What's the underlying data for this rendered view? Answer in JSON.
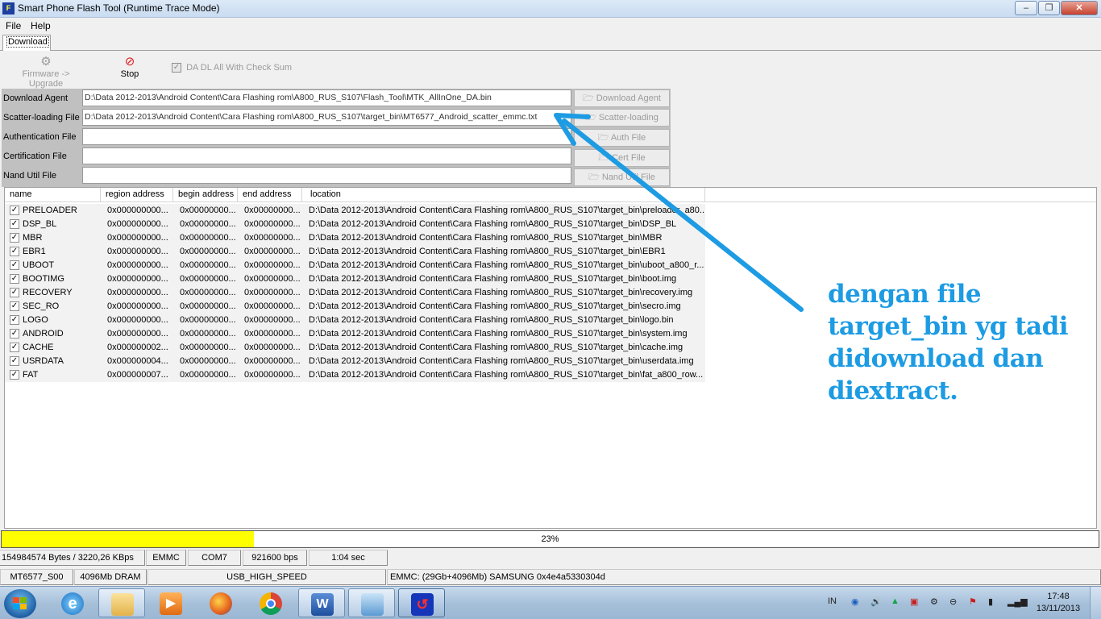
{
  "window": {
    "title": "Smart Phone Flash Tool (Runtime Trace Mode)",
    "icon_label": "F",
    "controls": [
      "‒",
      "❐",
      "✕"
    ]
  },
  "menu": [
    "File",
    "Help"
  ],
  "tabs": [
    "Download"
  ],
  "toolbar": {
    "firmware_upgrade": "Firmware -> Upgrade",
    "stop": "Stop",
    "checksum_label": "DA DL All With Check Sum",
    "checksum_checked": true
  },
  "files": [
    {
      "label": "Download Agent",
      "value": "D:\\Data 2012-2013\\Android Content\\Cara Flashing rom\\A800_RUS_S107\\Flash_Tool\\MTK_AllInOne_DA.bin",
      "button": "Download Agent"
    },
    {
      "label": "Scatter-loading File",
      "value": "D:\\Data 2012-2013\\Android Content\\Cara Flashing rom\\A800_RUS_S107\\target_bin\\MT6577_Android_scatter_emmc.txt",
      "button": "Scatter-loading"
    },
    {
      "label": "Authentication File",
      "value": "",
      "button": "Auth File"
    },
    {
      "label": "Certification File",
      "value": "",
      "button": "Cert File"
    },
    {
      "label": "Nand Util File",
      "value": "",
      "button": "Nand Util File"
    }
  ],
  "table": {
    "columns": [
      "name",
      "region address",
      "begin address",
      "end address",
      "location"
    ],
    "rows": [
      {
        "name": "PRELOADER",
        "region": "0x000000000...",
        "begin": "0x00000000...",
        "end": "0x00000000...",
        "location": "D:\\Data 2012-2013\\Android Content\\Cara Flashing rom\\A800_RUS_S107\\target_bin\\preloader_a80..."
      },
      {
        "name": "DSP_BL",
        "region": "0x000000000...",
        "begin": "0x00000000...",
        "end": "0x00000000...",
        "location": "D:\\Data 2012-2013\\Android Content\\Cara Flashing rom\\A800_RUS_S107\\target_bin\\DSP_BL"
      },
      {
        "name": "MBR",
        "region": "0x000000000...",
        "begin": "0x00000000...",
        "end": "0x00000000...",
        "location": "D:\\Data 2012-2013\\Android Content\\Cara Flashing rom\\A800_RUS_S107\\target_bin\\MBR"
      },
      {
        "name": "EBR1",
        "region": "0x000000000...",
        "begin": "0x00000000...",
        "end": "0x00000000...",
        "location": "D:\\Data 2012-2013\\Android Content\\Cara Flashing rom\\A800_RUS_S107\\target_bin\\EBR1"
      },
      {
        "name": "UBOOT",
        "region": "0x000000000...",
        "begin": "0x00000000...",
        "end": "0x00000000...",
        "location": "D:\\Data 2012-2013\\Android Content\\Cara Flashing rom\\A800_RUS_S107\\target_bin\\uboot_a800_r..."
      },
      {
        "name": "BOOTIMG",
        "region": "0x000000000...",
        "begin": "0x00000000...",
        "end": "0x00000000...",
        "location": "D:\\Data 2012-2013\\Android Content\\Cara Flashing rom\\A800_RUS_S107\\target_bin\\boot.img"
      },
      {
        "name": "RECOVERY",
        "region": "0x000000000...",
        "begin": "0x00000000...",
        "end": "0x00000000...",
        "location": "D:\\Data 2012-2013\\Android Content\\Cara Flashing rom\\A800_RUS_S107\\target_bin\\recovery.img"
      },
      {
        "name": "SEC_RO",
        "region": "0x000000000...",
        "begin": "0x00000000...",
        "end": "0x00000000...",
        "location": "D:\\Data 2012-2013\\Android Content\\Cara Flashing rom\\A800_RUS_S107\\target_bin\\secro.img"
      },
      {
        "name": "LOGO",
        "region": "0x000000000...",
        "begin": "0x00000000...",
        "end": "0x00000000...",
        "location": "D:\\Data 2012-2013\\Android Content\\Cara Flashing rom\\A800_RUS_S107\\target_bin\\logo.bin"
      },
      {
        "name": "ANDROID",
        "region": "0x000000000...",
        "begin": "0x00000000...",
        "end": "0x00000000...",
        "location": "D:\\Data 2012-2013\\Android Content\\Cara Flashing rom\\A800_RUS_S107\\target_bin\\system.img"
      },
      {
        "name": "CACHE",
        "region": "0x000000002...",
        "begin": "0x00000000...",
        "end": "0x00000000...",
        "location": "D:\\Data 2012-2013\\Android Content\\Cara Flashing rom\\A800_RUS_S107\\target_bin\\cache.img"
      },
      {
        "name": "USRDATA",
        "region": "0x000000004...",
        "begin": "0x00000000...",
        "end": "0x00000000...",
        "location": "D:\\Data 2012-2013\\Android Content\\Cara Flashing rom\\A800_RUS_S107\\target_bin\\userdata.img"
      },
      {
        "name": "FAT",
        "region": "0x000000007...",
        "begin": "0x00000000...",
        "end": "0x00000000...",
        "location": "D:\\Data 2012-2013\\Android Content\\Cara Flashing rom\\A800_RUS_S107\\target_bin\\fat_a800_row..."
      }
    ]
  },
  "annotation": {
    "lines": [
      "dengan file",
      "target_bin yg tadi",
      "didownload dan",
      "diextract."
    ],
    "color": "#1d9be3"
  },
  "progress": {
    "percent": 23,
    "label": "23%",
    "color": "#ffff00"
  },
  "status1": [
    "154984574 Bytes / 3220,26 KBps",
    "EMMC",
    "COM7",
    "921600 bps",
    "1:04 sec"
  ],
  "status2": [
    "MT6577_S00",
    "4096Mb DRAM",
    "USB_HIGH_SPEED",
    "EMMC: (29Gb+4096Mb) SAMSUNG 0x4e4a5330304d"
  ],
  "taskbar": {
    "apps": [
      "internet-explorer",
      "windows-explorer",
      "media-player",
      "firefox",
      "chrome",
      "word",
      "control-panel",
      "flash-tool"
    ],
    "tray_lang": "IN",
    "time": "17:48",
    "date": "13/11/2013"
  }
}
